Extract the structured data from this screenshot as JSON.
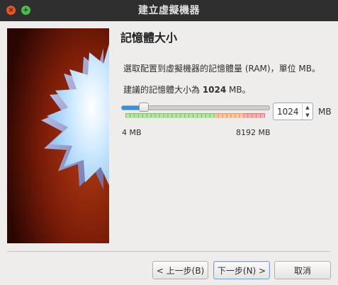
{
  "window": {
    "title": "建立虛擬機器",
    "close_glyph": "×",
    "maximize_glyph": "+"
  },
  "page": {
    "heading": "記憶體大小",
    "description": "選取配置到虛擬機器的記憶體量 (RAM)，單位 MB。",
    "recommendation_prefix": "建議的記憶體大小為 ",
    "recommendation_value": "1024",
    "recommendation_suffix": " MB。"
  },
  "memory": {
    "slider_min": 4,
    "slider_max": 8192,
    "value": 1024,
    "min_label": "4 MB",
    "max_label": "8192 MB",
    "spin_value": "1024",
    "unit": "MB",
    "zones": {
      "green_until_fraction": 0.64,
      "orange_until_fraction": 0.85
    }
  },
  "buttons": {
    "back": "< 上一步(B)",
    "next": "下一步(N) >",
    "cancel": "取消"
  },
  "colors": {
    "titlebar": "#2f2f2f",
    "close": "#e95420",
    "maximize": "#4bbf4b",
    "slider_fill": "#3d8fd8"
  },
  "icons": {
    "close": "close-icon",
    "maximize": "maximize-icon",
    "spin_up": "chevron-up-icon",
    "spin_down": "chevron-down-icon",
    "wizard_graphic": "starburst-illustration"
  }
}
